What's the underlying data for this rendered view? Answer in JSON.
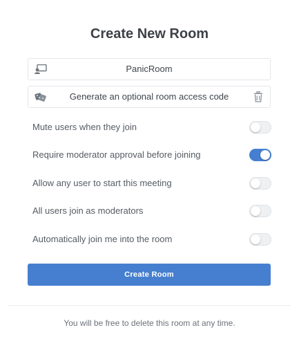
{
  "modal": {
    "title": "Create New Room"
  },
  "room_name": {
    "value": "PanicRoom",
    "icon": "room-name-icon"
  },
  "access_code": {
    "label": "Generate an optional room access code",
    "icon": "dice-icon",
    "delete_icon": "trash-icon"
  },
  "settings": [
    {
      "label": "Mute users when they join",
      "enabled": false
    },
    {
      "label": "Require moderator approval before joining",
      "enabled": true
    },
    {
      "label": "Allow any user to start this meeting",
      "enabled": false
    },
    {
      "label": "All users join as moderators",
      "enabled": false
    },
    {
      "label": "Automatically join me into the room",
      "enabled": false
    }
  ],
  "actions": {
    "create_label": "Create Room"
  },
  "footer": {
    "text": "You will be free to delete this room at any time."
  },
  "colors": {
    "accent": "#467fcf",
    "toggle_off": "#eef0f2",
    "title": "#3d4147"
  }
}
